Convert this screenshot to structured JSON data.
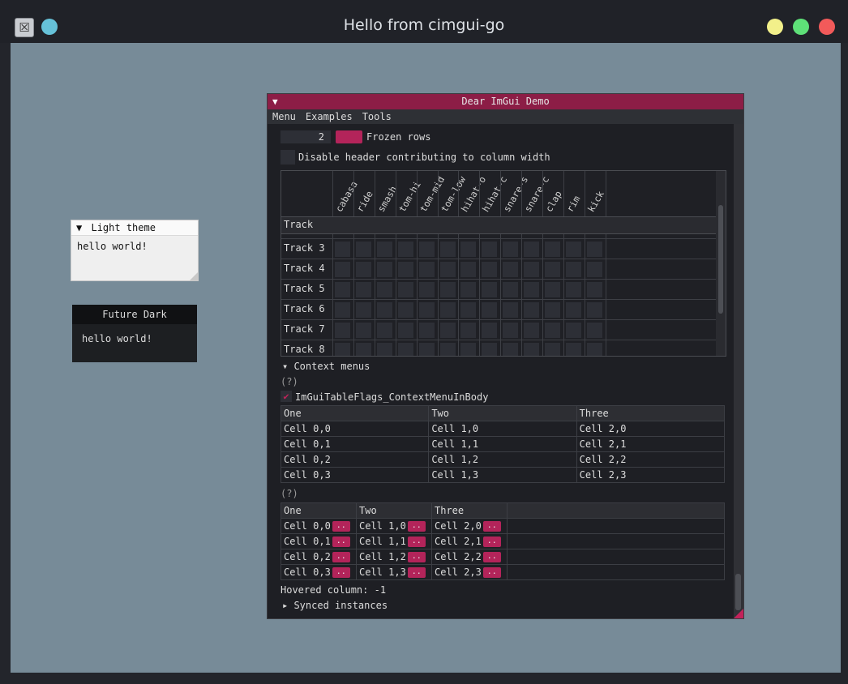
{
  "os_window": {
    "title": "Hello from cimgui-go",
    "app_icon": "x-app-icon",
    "button_colors": {
      "minimize": "#f2f08a",
      "maximize": "#5ee078",
      "close": "#f25a5a",
      "extra": "#66c1d8"
    }
  },
  "light_window": {
    "title": "Light theme",
    "collapse_glyph": "▼",
    "text": "hello world!"
  },
  "dark_window": {
    "title": "Future Dark",
    "text": "hello world!"
  },
  "demo": {
    "title": "Dear ImGui Demo",
    "collapse_glyph": "▼",
    "menu": [
      "Menu",
      "Examples",
      "Tools"
    ],
    "frozen_rows_value": "2",
    "frozen_rows_label": "Frozen rows",
    "disable_header_label": "Disable header contributing to column width",
    "drum_table": {
      "columns": [
        "cabasa",
        "ride",
        "smash",
        "tom-hi",
        "tom-mid",
        "tom-low",
        "hihat-o",
        "hihat-c",
        "snare-s",
        "snare-c",
        "clap",
        "rim",
        "kick"
      ],
      "header": "Track",
      "rows": [
        "Track 3",
        "Track 4",
        "Track 5",
        "Track 6",
        "Track 7",
        "Track 8"
      ]
    },
    "context_menus_label": "Context menus",
    "help_marker": "(?)",
    "checkbox_label": "ImGuiTableFlags_ContextMenuInBody",
    "table1": {
      "headers": [
        "One",
        "Two",
        "Three"
      ],
      "rows": [
        [
          "Cell 0,0",
          "Cell 1,0",
          "Cell 2,0"
        ],
        [
          "Cell 0,1",
          "Cell 1,1",
          "Cell 2,1"
        ],
        [
          "Cell 0,2",
          "Cell 1,2",
          "Cell 2,2"
        ],
        [
          "Cell 0,3",
          "Cell 1,3",
          "Cell 2,3"
        ]
      ]
    },
    "help_marker2": "(?)",
    "table2": {
      "headers": [
        "One",
        "Two",
        "Three"
      ],
      "button_label": "..",
      "rows": [
        [
          "Cell 0,0",
          "Cell 1,0",
          "Cell 2,0"
        ],
        [
          "Cell 0,1",
          "Cell 1,1",
          "Cell 2,1"
        ],
        [
          "Cell 0,2",
          "Cell 1,2",
          "Cell 2,2"
        ],
        [
          "Cell 0,3",
          "Cell 1,3",
          "Cell 2,3"
        ]
      ]
    },
    "hovered_column": "Hovered column: -1",
    "synced_instances": "Synced instances"
  }
}
